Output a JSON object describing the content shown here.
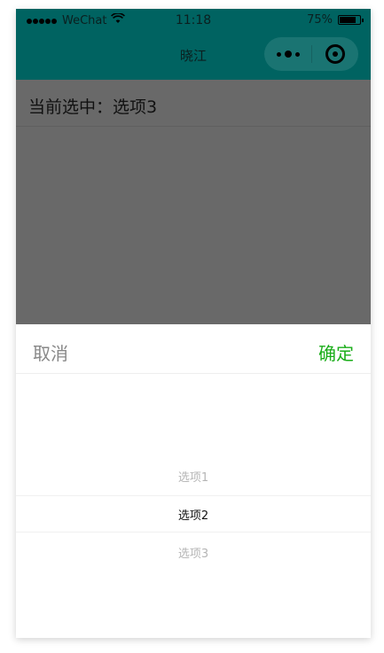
{
  "status_bar": {
    "carrier": "WeChat",
    "time": "11:18",
    "battery": "75%",
    "battery_level": 0.75
  },
  "nav": {
    "title": "晓江"
  },
  "capsule": {
    "more_icon": "more-dots-icon",
    "close_icon": "target-circle-icon"
  },
  "main": {
    "selected_label": "当前选中：选项3"
  },
  "picker": {
    "cancel_label": "取消",
    "confirm_label": "确定",
    "options": [
      "选项1",
      "选项2",
      "选项3"
    ],
    "highlighted_option": "选项2"
  },
  "colors": {
    "nav_bg": "#006361",
    "mask": "#696969",
    "confirm": "#1aad19",
    "cancel": "#888888"
  }
}
